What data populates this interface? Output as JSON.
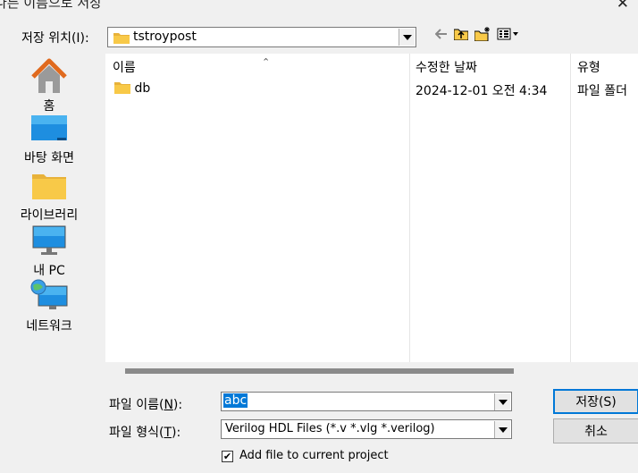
{
  "window": {
    "title": "다른 이름으로 저장",
    "close_glyph": "✕"
  },
  "save_in": {
    "label": "저장 위치(I):",
    "value": "tstroypost"
  },
  "toolbar": {
    "back_icon": "back-arrow-icon",
    "up_icon": "up-folder-icon",
    "new_folder_icon": "new-folder-icon",
    "view_icon": "view-menu-icon"
  },
  "places": [
    {
      "label": "홈",
      "icon": "home-icon"
    },
    {
      "label": "바탕 화면",
      "icon": "desktop-icon"
    },
    {
      "label": "라이브러리",
      "icon": "library-icon"
    },
    {
      "label": "내 PC",
      "icon": "computer-icon"
    },
    {
      "label": "네트워크",
      "icon": "network-icon"
    }
  ],
  "file_list": {
    "columns": [
      "이름",
      "수정한 날짜",
      "유형"
    ],
    "rows": [
      {
        "name": "db",
        "modified": "2024-12-01 오전 4:34",
        "type": "파일 폴더"
      }
    ]
  },
  "file_name": {
    "label": "파일 이름(N):",
    "value": "abc"
  },
  "file_type": {
    "label": "파일 형식(T):",
    "value": "Verilog HDL Files (*.v *.vlg *.verilog)"
  },
  "buttons": {
    "save": "저장(S)",
    "cancel": "취소"
  },
  "add_file": {
    "label": "Add file to current project",
    "checked": true,
    "check_glyph": "✔"
  },
  "colors": {
    "accent": "#0078d7",
    "folder": "#f8c948",
    "background": "#f0f0f0"
  }
}
